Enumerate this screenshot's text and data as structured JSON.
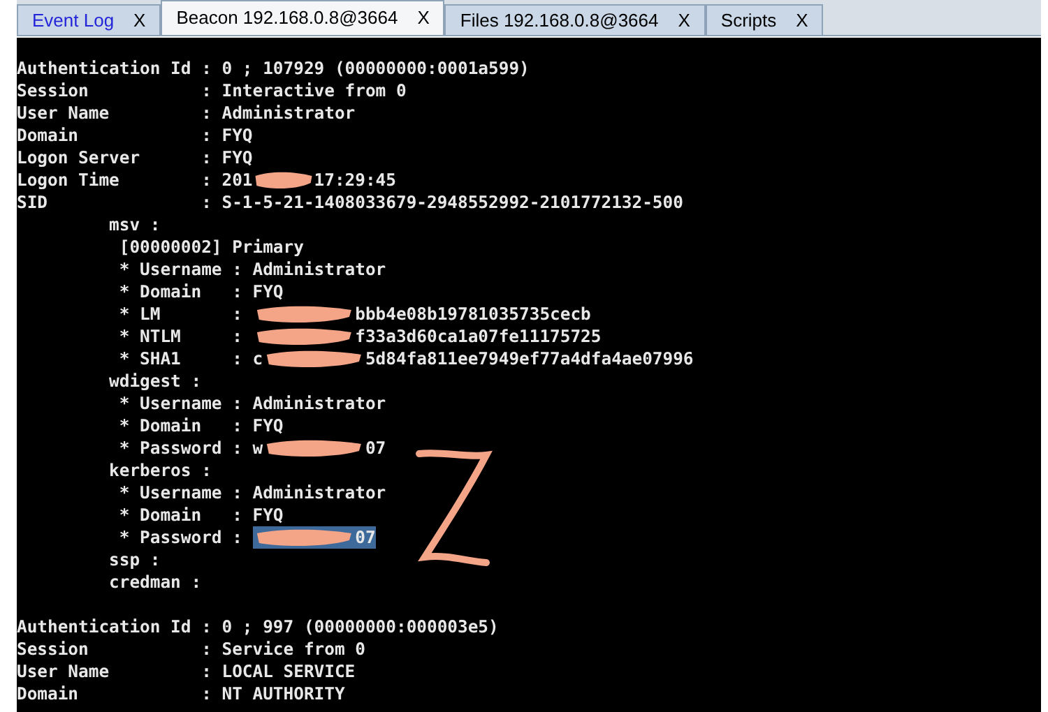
{
  "tabs": [
    {
      "label": "Event Log",
      "close": "X",
      "selected": false,
      "alert": true
    },
    {
      "label": "Beacon 192.168.0.8@3664",
      "close": "X",
      "selected": true,
      "alert": false
    },
    {
      "label": "Files 192.168.0.8@3664",
      "close": "X",
      "selected": false,
      "alert": false
    },
    {
      "label": "Scripts",
      "close": "X",
      "selected": false,
      "alert": false
    }
  ],
  "console": {
    "blocks": [
      {
        "lines": [
          {
            "segments": [
              {
                "kind": "text",
                "text": "Authentication Id : 0 ; 107929 (00000000:0001a599)"
              }
            ]
          },
          {
            "segments": [
              {
                "kind": "text",
                "text": "Session           : Interactive from 0"
              }
            ]
          },
          {
            "segments": [
              {
                "kind": "text",
                "text": "User Name         : Administrator"
              }
            ]
          },
          {
            "segments": [
              {
                "kind": "text",
                "text": "Domain            : FYQ"
              }
            ]
          },
          {
            "segments": [
              {
                "kind": "text",
                "text": "Logon Server      : FYQ"
              }
            ]
          },
          {
            "segments": [
              {
                "kind": "text",
                "text": "Logon Time        : 201"
              },
              {
                "kind": "short_scribble"
              },
              {
                "kind": "text",
                "text": "17:29:45"
              }
            ]
          },
          {
            "segments": [
              {
                "kind": "text",
                "text": "SID               : S-1-5-21-1408033679-2948552992-2101772132-500"
              }
            ]
          },
          {
            "segments": [
              {
                "kind": "text",
                "text": "         msv :"
              }
            ]
          },
          {
            "segments": [
              {
                "kind": "text",
                "text": "          [00000002] Primary"
              }
            ]
          },
          {
            "segments": [
              {
                "kind": "text",
                "text": "          * Username : Administrator"
              }
            ]
          },
          {
            "segments": [
              {
                "kind": "text",
                "text": "          * Domain   : FYQ"
              }
            ]
          },
          {
            "segments": [
              {
                "kind": "text",
                "text": "          * LM       : "
              },
              {
                "kind": "scribble"
              },
              {
                "kind": "text",
                "text": "bbb4e08b19781035735cecb"
              }
            ]
          },
          {
            "segments": [
              {
                "kind": "text",
                "text": "          * NTLM     : "
              },
              {
                "kind": "scribble"
              },
              {
                "kind": "text",
                "text": "f33a3d60ca1a07fe11175725"
              }
            ]
          },
          {
            "segments": [
              {
                "kind": "text",
                "text": "          * SHA1     : c"
              },
              {
                "kind": "scribble"
              },
              {
                "kind": "text",
                "text": "5d84fa811ee7949ef77a4dfa4ae07996"
              }
            ]
          },
          {
            "segments": [
              {
                "kind": "text",
                "text": "         wdigest :"
              }
            ]
          },
          {
            "segments": [
              {
                "kind": "text",
                "text": "          * Username : Administrator"
              }
            ]
          },
          {
            "segments": [
              {
                "kind": "text",
                "text": "          * Domain   : FYQ"
              }
            ]
          },
          {
            "segments": [
              {
                "kind": "text",
                "text": "          * Password : w"
              },
              {
                "kind": "scribble"
              },
              {
                "kind": "text",
                "text": "07"
              }
            ]
          },
          {
            "segments": [
              {
                "kind": "text",
                "text": "         kerberos :"
              }
            ]
          },
          {
            "segments": [
              {
                "kind": "text",
                "text": "          * Username : Administrator"
              }
            ]
          },
          {
            "segments": [
              {
                "kind": "text",
                "text": "          * Domain   : FYQ"
              }
            ]
          },
          {
            "segments": [
              {
                "kind": "text",
                "text": "          * Password : "
              },
              {
                "kind": "highlighted_scribble"
              },
              {
                "kind": "highlighted_text",
                "text": "07"
              }
            ]
          },
          {
            "segments": [
              {
                "kind": "text",
                "text": "         ssp :"
              }
            ]
          },
          {
            "segments": [
              {
                "kind": "text",
                "text": "         credman :"
              }
            ]
          }
        ]
      },
      {
        "lines": [
          {
            "segments": [
              {
                "kind": "text",
                "text": "Authentication Id : 0 ; 997 (00000000:000003e5)"
              }
            ]
          },
          {
            "segments": [
              {
                "kind": "text",
                "text": "Session           : Service from 0"
              }
            ]
          },
          {
            "segments": [
              {
                "kind": "text",
                "text": "User Name         : LOCAL SERVICE"
              }
            ]
          },
          {
            "segments": [
              {
                "kind": "text",
                "text": "Domain            : NT AUTHORITY"
              }
            ]
          }
        ]
      }
    ]
  }
}
